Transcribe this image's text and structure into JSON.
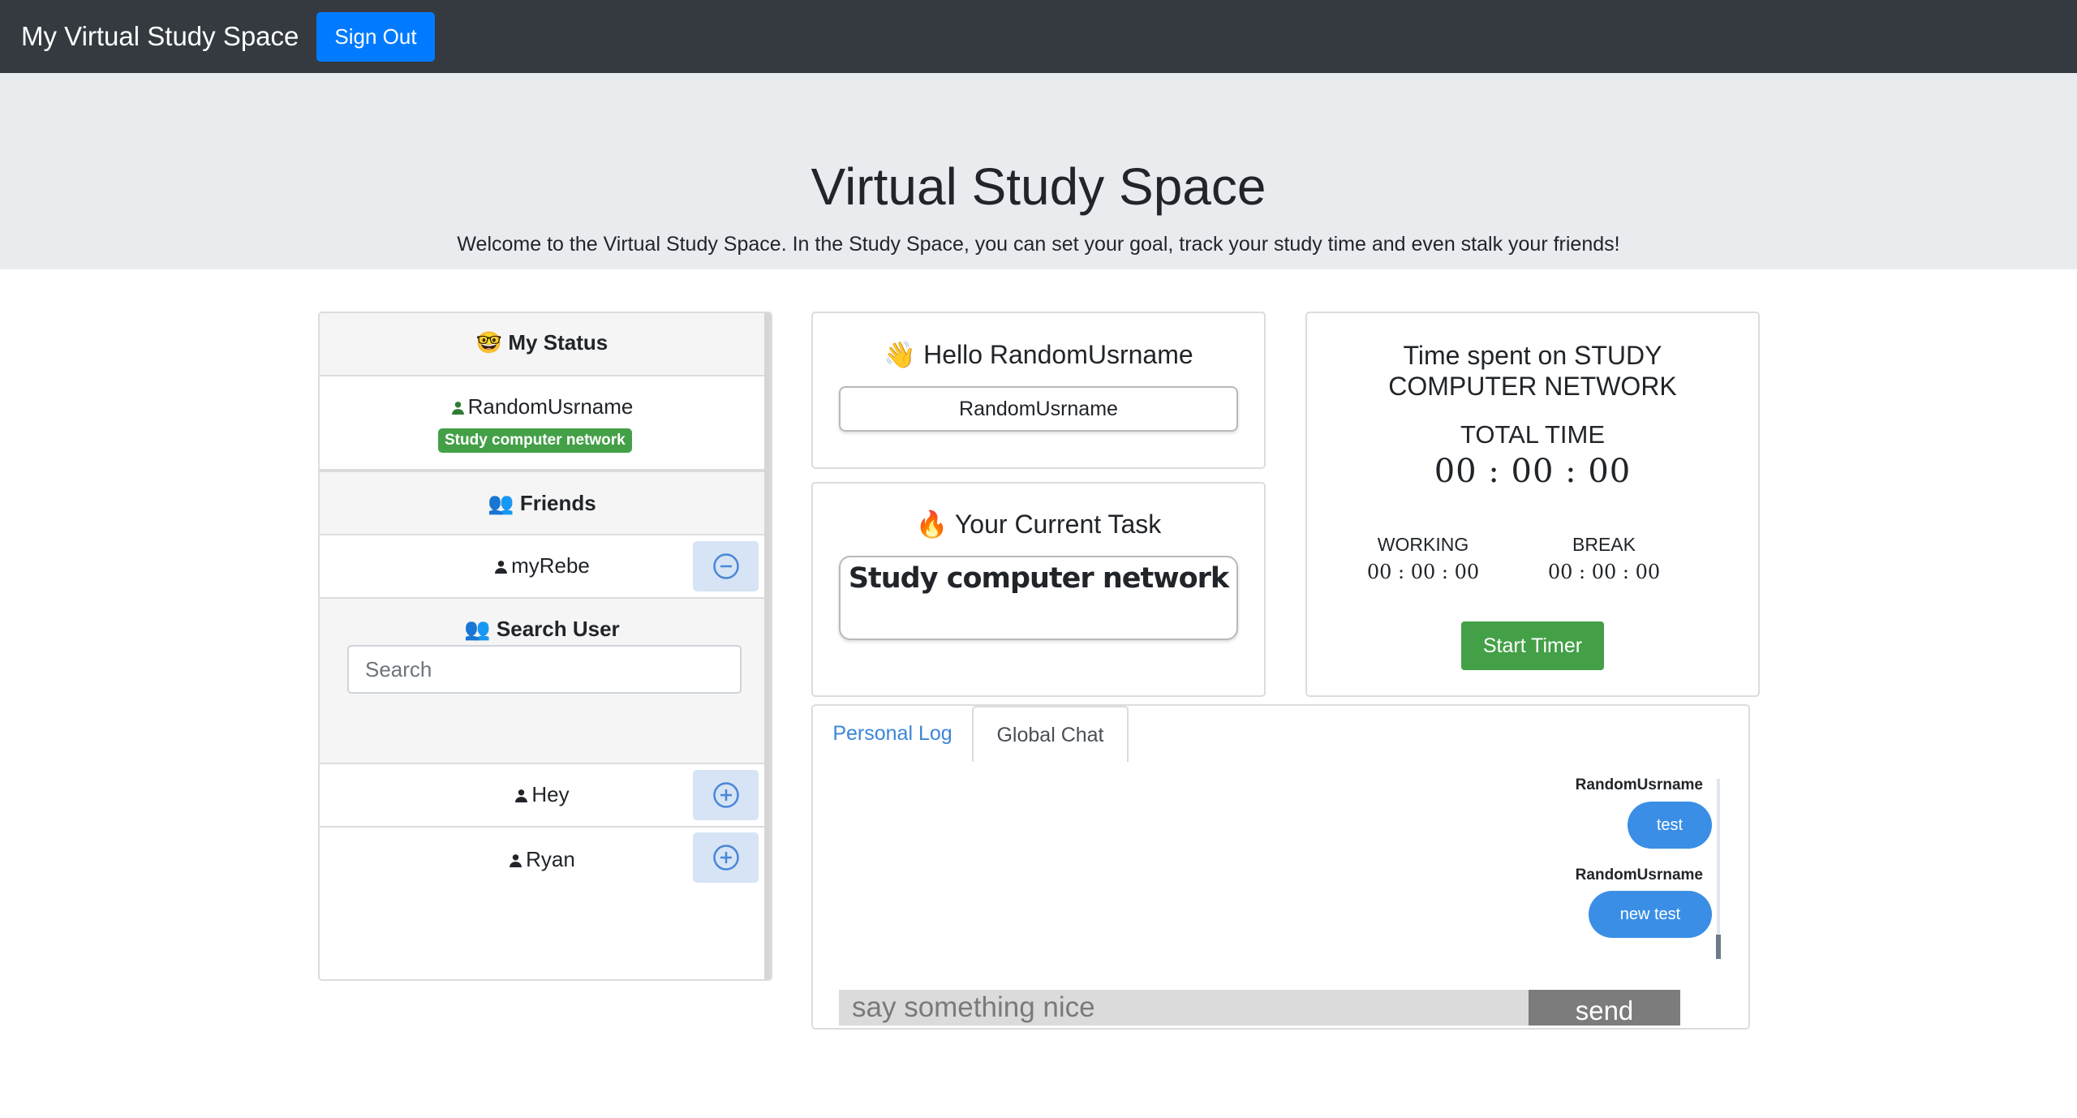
{
  "navbar": {
    "brand": "My Virtual Study Space",
    "signout_label": "Sign Out"
  },
  "jumbotron": {
    "title": "Virtual Study Space",
    "subtitle": "Welcome to the Virtual Study Space. In the Study Space, you can set your goal, track your study time and even stalk your friends!"
  },
  "status": {
    "header": "🤓 My Status",
    "username": "RandomUsrname",
    "badge": "Study computer network"
  },
  "friends": {
    "header": "👥 Friends",
    "items": [
      {
        "name": "myRebe",
        "action": "remove"
      }
    ]
  },
  "search": {
    "header": "👥 Search User",
    "placeholder": "Search",
    "results": [
      {
        "name": "Hey",
        "action": "add"
      },
      {
        "name": "Ryan",
        "action": "add"
      }
    ]
  },
  "hello": {
    "title": "👋 Hello RandomUsrname",
    "name_value": "RandomUsrname"
  },
  "task": {
    "title": "🔥 Your Current Task",
    "value": "Study computer network"
  },
  "timer": {
    "title_line1": "Time spent on STUDY",
    "title_line2": "COMPUTER NETWORK",
    "total_label": "TOTAL TIME",
    "total_value": "00 : 00 : 00",
    "working_label": "WORKING",
    "working_value": "00 : 00 : 00",
    "break_label": "BREAK",
    "break_value": "00 : 00 : 00",
    "start_label": "Start Timer"
  },
  "chat": {
    "tabs": [
      {
        "label": "Personal Log"
      },
      {
        "label": "Global Chat"
      }
    ],
    "messages": [
      {
        "user": "RandomUsrname",
        "text": "test"
      },
      {
        "user": "RandomUsrname",
        "text": "new test"
      }
    ],
    "input_placeholder": "say something nice",
    "send_label": "send"
  },
  "colors": {
    "navbar": "#343a40",
    "primary": "#007bff",
    "success": "#43a047",
    "bubble": "#3a8ee6"
  }
}
